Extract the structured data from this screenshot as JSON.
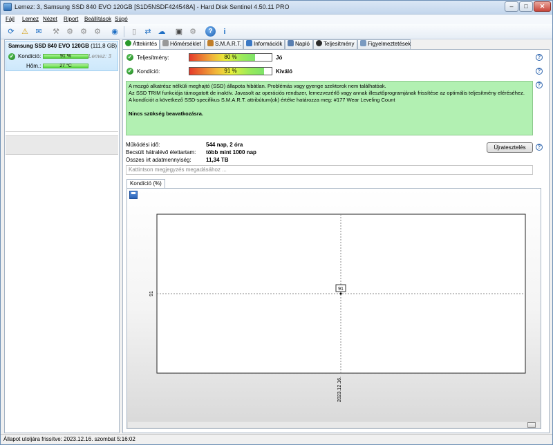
{
  "window": {
    "title": "Lemez: 3, Samsung SSD 840 EVO 120GB [S1D5NSDF424548A]  -  Hard Disk Sentinel 4.50.11 PRO",
    "min": "–",
    "max": "□",
    "close": "✕"
  },
  "menu": [
    "Fájl",
    "Lemez",
    "Nézet",
    "Riport",
    "Beállítások",
    "Súgó"
  ],
  "left_panel": {
    "disk_name": "Samsung SSD 840 EVO 120GB",
    "disk_size": "(111,8 GB)",
    "condition_label": "Kondíció:",
    "condition_value": "91 %",
    "disk_index": "Lemez: 3",
    "temp_label": "Hőm.:",
    "temp_value": "27 °C"
  },
  "tabs": [
    "Áttekintés",
    "Hőmérséklet",
    "S.M.A.R.T.",
    "Információk",
    "Napló",
    "Teljesítmény",
    "Figyelmeztetések"
  ],
  "overview": {
    "performance_label": "Teljesítmény:",
    "performance_value": "80 %",
    "performance_percent": 80,
    "performance_quality": "Jó",
    "condition_label": "Kondíció:",
    "condition_value": "91 %",
    "condition_percent": 91,
    "condition_quality": "Kiváló",
    "message_lines": [
      "A mozgó alkatrész nélküli meghajtó (SSD) állapota hibátlan. Problémás vagy gyenge szektorok nem találhatóak.",
      "Az SSD TRIM funkciója támogatott de inaktív. Javasolt az operációs rendszer, lemezvezérlő vagy annak illesztőprogramjának frissítése az optimális teljesítmény eléréséhez.",
      "A kondíciót a következő SSD-specifikus S.M.A.R.T. attribútum(ok) értéke határozza meg:  #177 Wear Leveling Count"
    ],
    "message_strong": "Nincs szükség beavatkozásra.",
    "uptime_label": "Működési idő:",
    "uptime_value": "544 nap, 2 óra",
    "remaining_label": "Becsült hátralévő élettartam:",
    "remaining_value": "több mint 1000 nap",
    "written_label": "Összes írt adatmennyiség:",
    "written_value": "11,34 TB",
    "retest_button": "Újratesztelés",
    "note_placeholder": "Kattintson megjegyzés megadásához ..."
  },
  "chart_tab": "Kondíció  (%)",
  "chart_data": {
    "type": "line",
    "x": [
      "2023.12.16."
    ],
    "series": [
      {
        "values": [
          91
        ]
      }
    ],
    "ytick": "91",
    "xtick": "2023.12.16.",
    "point_label": "91"
  },
  "status": "Állapot utoljára frissítve: 2023.12.16. szombat 5:16:02",
  "colors": {
    "good_green": "#b2f0b2",
    "selection_blue": "#cde8fb"
  }
}
